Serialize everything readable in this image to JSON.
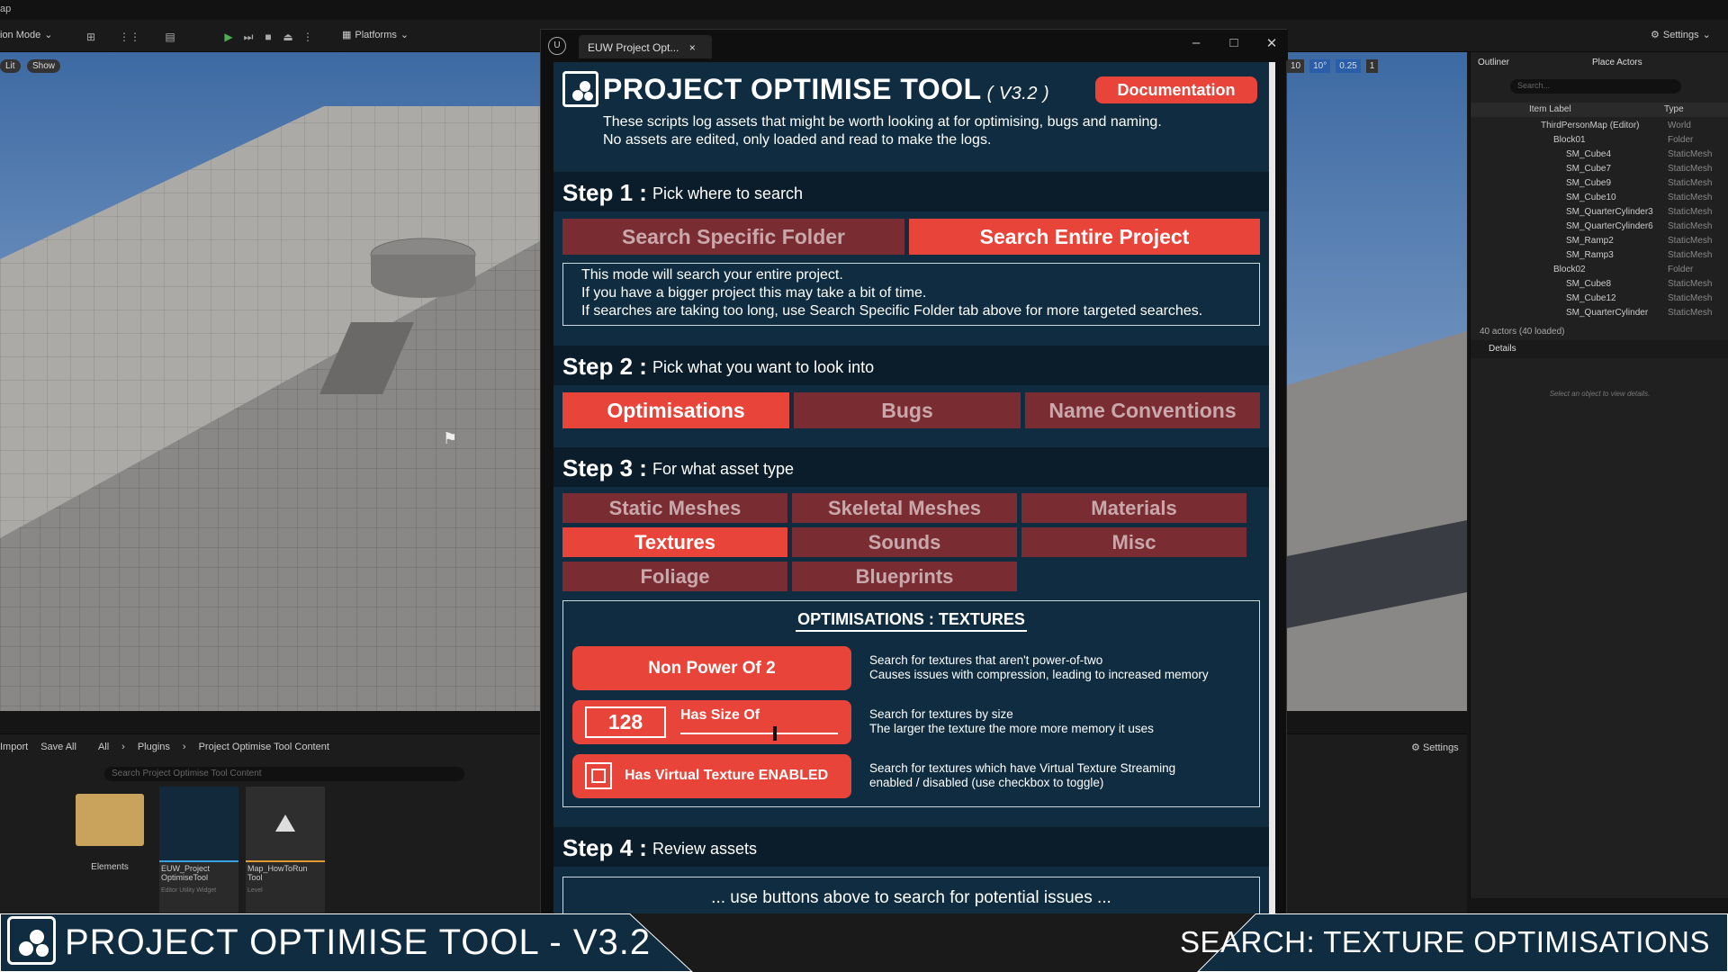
{
  "topbar": {
    "map_label": "ap",
    "mode_label": "ion Mode",
    "platforms_label": "Platforms",
    "settings_label": "Settings"
  },
  "viewport": {
    "lit_label": "Lit",
    "show_label": "Show",
    "right_controls": [
      "10",
      "10°",
      "0.25",
      "1"
    ]
  },
  "plugin": {
    "tab_title": "EUW Project Opt...",
    "title": "PROJECT OPTIMISE TOOL",
    "version": "( V3.2 )",
    "documentation_label": "Documentation",
    "description": [
      "These scripts log assets that might be worth looking at for optimising, bugs and naming.",
      "No assets are edited, only loaded and read to make the logs."
    ],
    "step1": {
      "num": "Step 1 :",
      "sub": "Pick where to search",
      "btn_folder": "Search Specific Folder",
      "btn_project": "Search Entire Project",
      "info": [
        "This mode will search your entire project.",
        "If you have a bigger project this may take a bit of time.",
        "If searches are taking too long, use Search Specific Folder tab above for more targeted searches."
      ]
    },
    "step2": {
      "num": "Step 2 :",
      "sub": "Pick what you want to look into",
      "btn_optimisations": "Optimisations",
      "btn_bugs": "Bugs",
      "btn_names": "Name Conventions"
    },
    "step3": {
      "num": "Step 3 :",
      "sub": "For what asset type",
      "types": [
        "Static Meshes",
        "Skeletal Meshes",
        "Materials",
        "Textures",
        "Sounds",
        "Misc",
        "Foliage",
        "Blueprints"
      ]
    },
    "options": {
      "title": "OPTIMISATIONS : TEXTURES",
      "non_power_label": "Non Power Of 2",
      "non_power_desc": [
        "Search for textures that aren't power-of-two",
        "Causes issues with compression, leading to increased memory"
      ],
      "size_value": "128",
      "size_label": "Has Size Of",
      "size_slider_fraction": 0.6,
      "size_desc": [
        "Search for textures by size",
        "The larger the texture the more more memory it uses"
      ],
      "vt_label": "Has Virtual Texture ENABLED",
      "vt_desc": [
        "Search for textures which have Virtual Texture Streaming",
        "enabled / disabled (use checkbox to toggle)"
      ]
    },
    "step4": {
      "num": "Step 4 :",
      "sub": "Review assets",
      "placeholder": "... use buttons above to search for potential issues ..."
    }
  },
  "content_browser": {
    "import_label": "Import",
    "save_all_label": "Save All",
    "path": [
      "All",
      "Plugins",
      "Project Optimise Tool Content"
    ],
    "search_placeholder": "Search Project Optimise Tool Content",
    "settings_label": "Settings",
    "assets": [
      {
        "name": "Elements",
        "type": ""
      },
      {
        "name": "EUW_Project OptimiseTool",
        "type": "Editor Utility Widget"
      },
      {
        "name": "Map_HowToRun Tool",
        "type": "Level"
      }
    ]
  },
  "outliner": {
    "tab": "Outliner",
    "place_actors": "Place Actors",
    "search_placeholder": "Search...",
    "col_label": "Item Label",
    "col_type": "Type",
    "rows": [
      {
        "name": "ThirdPersonMap (Editor)",
        "type": "World",
        "indent": 0
      },
      {
        "name": "Block01",
        "type": "Folder",
        "indent": 1
      },
      {
        "name": "SM_Cube4",
        "type": "StaticMesh",
        "indent": 2
      },
      {
        "name": "SM_Cube7",
        "type": "StaticMesh",
        "indent": 2
      },
      {
        "name": "SM_Cube9",
        "type": "StaticMesh",
        "indent": 2
      },
      {
        "name": "SM_Cube10",
        "type": "StaticMesh",
        "indent": 2
      },
      {
        "name": "SM_QuarterCylinder3",
        "type": "StaticMesh",
        "indent": 2
      },
      {
        "name": "SM_QuarterCylinder6",
        "type": "StaticMesh",
        "indent": 2
      },
      {
        "name": "SM_Ramp2",
        "type": "StaticMesh",
        "indent": 2
      },
      {
        "name": "SM_Ramp3",
        "type": "StaticMesh",
        "indent": 2
      },
      {
        "name": "Block02",
        "type": "Folder",
        "indent": 1
      },
      {
        "name": "SM_Cube8",
        "type": "StaticMesh",
        "indent": 2
      },
      {
        "name": "SM_Cube12",
        "type": "StaticMesh",
        "indent": 2
      },
      {
        "name": "SM_QuarterCylinder",
        "type": "StaticMesh",
        "indent": 2
      }
    ],
    "status": "40 actors (40 loaded)",
    "details_tab": "Details",
    "details_empty": "Select an object to view details."
  },
  "banner": {
    "left": "PROJECT OPTIMISE TOOL  -  V3.2",
    "right": "SEARCH: TEXTURE OPTIMISATIONS"
  }
}
